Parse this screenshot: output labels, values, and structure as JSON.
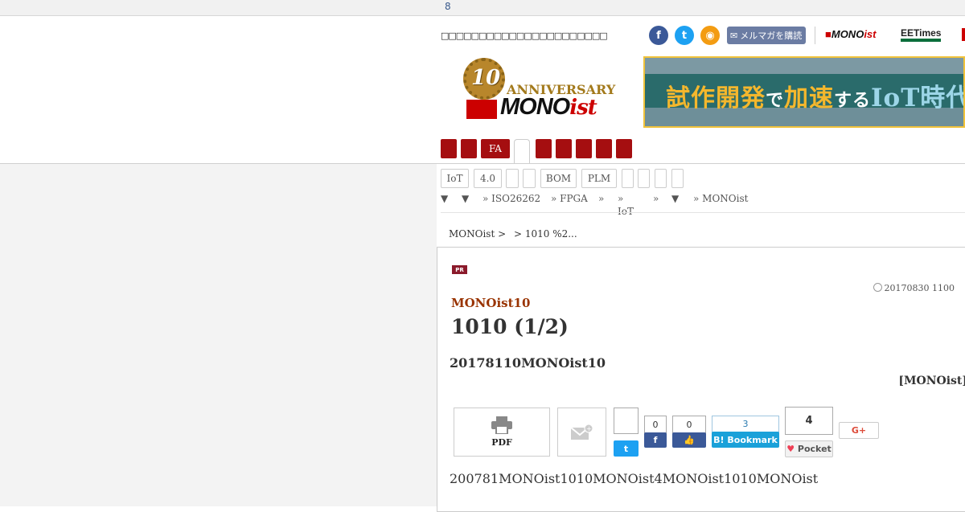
{
  "topbar": {
    "number": "8"
  },
  "header": {
    "tagline": "□□□□□□□□□□□□□□□□□□□□□□",
    "social": {
      "facebook": "f",
      "twitter": "t",
      "rss": "◉"
    },
    "mailmag_label": "メルマガを購読",
    "sites": {
      "monoist_a": "MONO",
      "monoist_b": "ist",
      "eetimes": "EETimes"
    },
    "logo": {
      "ten": "10",
      "anniversary": "ANNIVERSARY",
      "mono": "MONO",
      "ist": "ist"
    },
    "banner": {
      "part1": "試作開発",
      "part2": "で",
      "part3": "加速",
      "part4": "する",
      "part5": "IoT",
      "part6": "時代"
    }
  },
  "nav": {
    "fa_label": "FA"
  },
  "tags": {
    "iot": "IoT",
    "four": "4.0",
    "bom": "BOM",
    "plm": "PLM"
  },
  "subnav": {
    "arrow": "▼",
    "iso": "» ISO26262",
    "fpga": "» FPGA",
    "raquo": "»",
    "iot": "IoT",
    "monoist": "» MONOist"
  },
  "breadcrumb": {
    "home": "MONOist >",
    "current": "> 1010 %2..."
  },
  "article": {
    "pr_badge": "PR",
    "date": "20170830 1100",
    "series": "MONOist10",
    "title": "1010 (1/2)",
    "lead": "20178110MONOist10",
    "byline": "[MONOist]",
    "pdf_label": "PDF",
    "tweet_count": "",
    "facebook_count": "0",
    "like_count": "0",
    "hatena_count": "3",
    "hatena_label": "Bookmark",
    "pocket_count": "4",
    "pocket_label": "Pocket",
    "gplus_label": "G+",
    "body": "200781MONOist1010MONOist4MONOist1010MONOist"
  },
  "colors": {
    "nav_red": "#a50e10",
    "series_brown": "#993300",
    "accent_gold": "#f4b72d"
  }
}
